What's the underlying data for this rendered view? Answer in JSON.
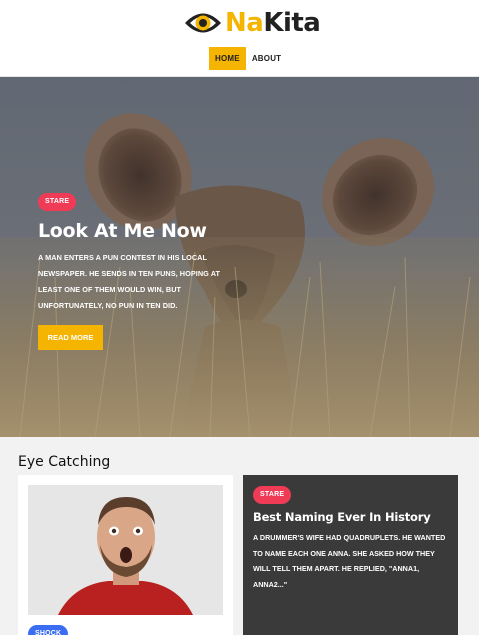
{
  "brand": {
    "name_part1": "Na",
    "name_part2": "Kita",
    "colors": {
      "accent": "#f5b400",
      "dark": "#222222"
    }
  },
  "nav": {
    "items": [
      {
        "label": "HOME",
        "active": true
      },
      {
        "label": "ABOUT",
        "active": false
      }
    ]
  },
  "hero": {
    "badge": "STARE",
    "title": "Look At Me Now",
    "text": "A man enters a pun contest in his local newspaper. He sends in ten puns, hoping at least one of them would win, but unfortunately, no pun in ten did.",
    "button": "READ MORE"
  },
  "section": {
    "title": "Eye Catching",
    "cards": [
      {
        "badge": "SHOCK",
        "image": "surprised-man-photo"
      },
      {
        "badge": "STARE",
        "title": "Best Naming Ever In History",
        "text": "A drummer's wife had quadruplets. He wanted to name each one Anna. She asked how they will tell them apart. He replied, \"Anna1, Anna2...\""
      }
    ]
  },
  "colors": {
    "badge_red": "#ef3b56",
    "badge_blue": "#3b6df2",
    "card_dark": "#3a3a3a",
    "page_bg": "#f2f2f2"
  },
  "icons": {
    "logo": "eye-icon"
  }
}
